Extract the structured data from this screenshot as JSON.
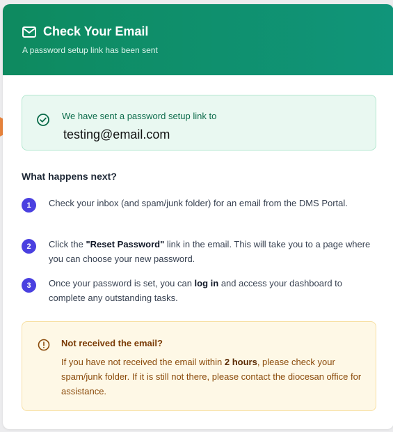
{
  "header": {
    "title": "Check Your Email",
    "subtitle": "A password setup link has been sent",
    "icon": "mail-icon"
  },
  "success": {
    "message": "We have sent a password setup link to",
    "email": "testing@email.com",
    "icon": "check-circle-icon"
  },
  "next": {
    "title": "What happens next?",
    "steps": [
      {
        "number": "1",
        "text": "Check your inbox (and spam/junk folder) for an email from the DMS Portal."
      },
      {
        "number": "2",
        "pre": "Click the ",
        "bold": "\"Reset Password\"",
        "post": " link in the email. This will take you to a page where you can choose your new password."
      },
      {
        "number": "3",
        "pre": "Once your password is set, you can ",
        "bold": "log in",
        "post": " and access your dashboard to complete any outstanding tasks."
      }
    ]
  },
  "warning": {
    "title": "Not received the email?",
    "pre": "If you have not received the email within ",
    "bold": "2 hours",
    "post": ", please check your spam/junk folder. If it is still not there, please contact the diocesan office for assistance.",
    "icon": "alert-circle-icon"
  },
  "colors": {
    "header_green": "#0e8a5f",
    "step_badge": "#4a40e0",
    "pointer_orange": "#e7833b",
    "success_bg": "#e9f8f1",
    "warning_bg": "#fef8e6"
  }
}
